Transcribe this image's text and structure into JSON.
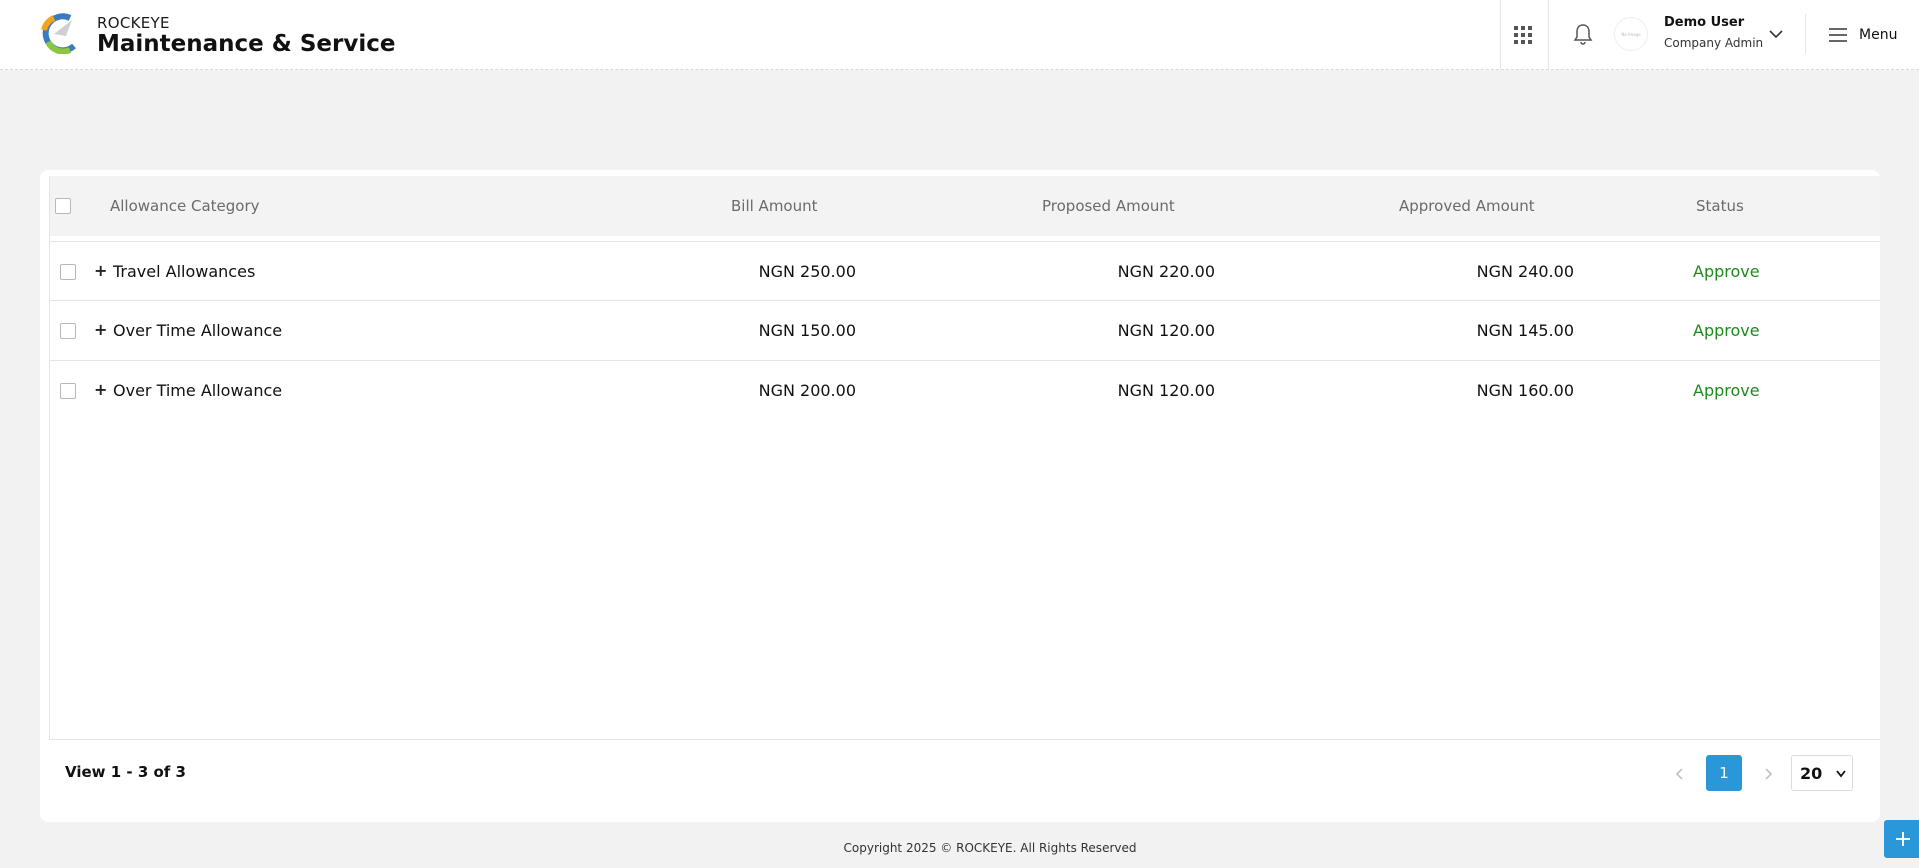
{
  "header": {
    "brand": "ROCKEYE",
    "app_title": "Maintenance & Service",
    "avatar_text": "No Image",
    "user_name": "Demo User",
    "user_role": "Company Admin",
    "menu_label": "Menu"
  },
  "table": {
    "columns": [
      "Allowance Category",
      "Bill Amount",
      "Proposed Amount",
      "Approved Amount",
      "Status"
    ],
    "rows": [
      {
        "category": "Travel Allowances",
        "bill": "NGN 250.00",
        "proposed": "NGN 220.00",
        "approved": "NGN 240.00",
        "status": "Approve"
      },
      {
        "category": "Over Time Allowance",
        "bill": "NGN 150.00",
        "proposed": "NGN 120.00",
        "approved": "NGN 145.00",
        "status": "Approve"
      },
      {
        "category": "Over Time Allowance",
        "bill": "NGN 200.00",
        "proposed": "NGN 120.00",
        "approved": "NGN 160.00",
        "status": "Approve"
      }
    ],
    "expand_glyph": "+"
  },
  "pagination": {
    "view_text": "View 1 - 3 of 3",
    "current_page": "1",
    "page_size": "20"
  },
  "footer": {
    "copyright": "Copyright 2025 © ROCKEYE. All Rights Reserved"
  },
  "colors": {
    "accent": "#2a98d8",
    "status_approve": "#1e8a1e"
  }
}
